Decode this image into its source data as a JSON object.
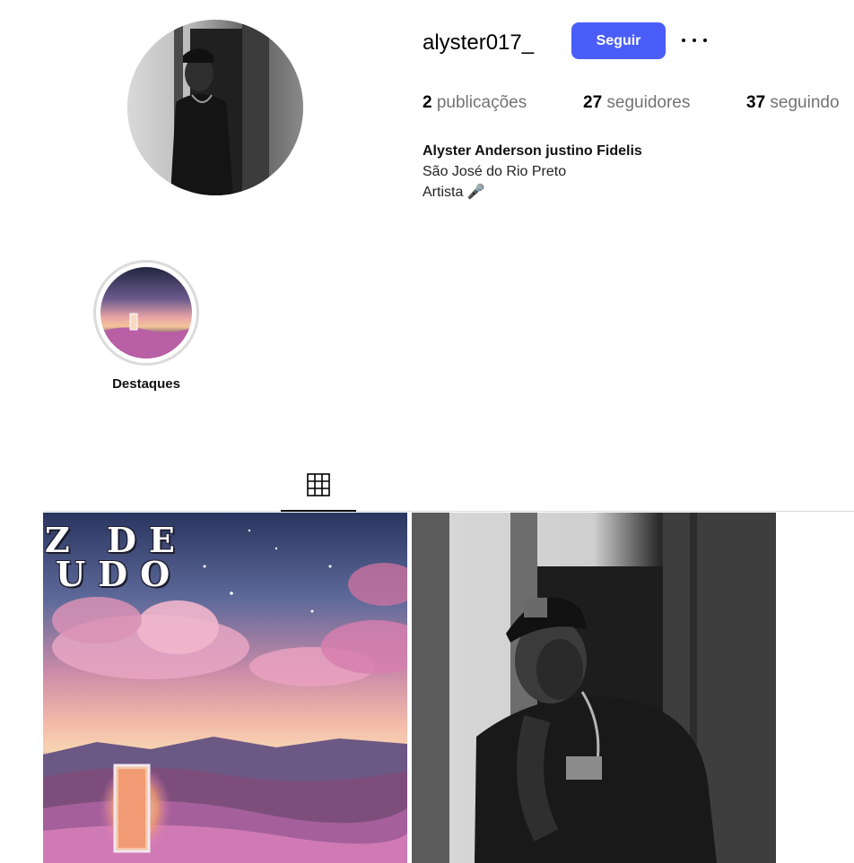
{
  "profile": {
    "username": "alyster017_",
    "follow_label": "Seguir",
    "more_icon": "ellipsis-icon",
    "stats": {
      "posts_count": "2",
      "posts_label": "publicações",
      "followers_count": "27",
      "followers_label": "seguidores",
      "following_count": "37",
      "following_label": "seguindo"
    },
    "bio": {
      "full_name": "Alyster Anderson justino Fidelis",
      "location": "São José do Rio Preto",
      "occupation": "Artista 🎤"
    }
  },
  "highlights": [
    {
      "label": "Destaques"
    }
  ],
  "tabs": {
    "active": "grid-icon"
  },
  "posts": [
    {
      "cover_line_1": "Z DE",
      "cover_line_2": "UDO",
      "kind": "album-cover"
    },
    {
      "kind": "photo"
    }
  ],
  "colors": {
    "accent": "#4a5df9",
    "divider": "#dbdbdb",
    "muted_text": "#737373"
  }
}
